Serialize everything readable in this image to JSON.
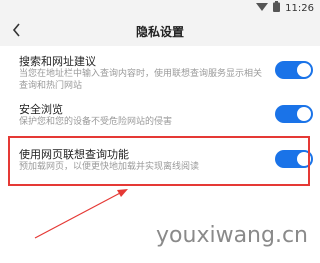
{
  "status_bar": {
    "time": "11:26",
    "icons": [
      "wifi-icon",
      "battery-icon"
    ]
  },
  "header": {
    "title": "隐私设置",
    "back_icon": "chevron-left-icon"
  },
  "settings": [
    {
      "title": "搜索和网址建议",
      "description": "当您在地址栏中输入查询内容时，使用联想查询服务显示相关查询和热门网站",
      "enabled": true
    },
    {
      "title": "安全浏览",
      "description": "保护您和您的设备不受危险网站的侵害",
      "enabled": true
    },
    {
      "title": "使用网页联想查询功能",
      "description": "预加载网页，以便更快地加载并实现离线阅读",
      "enabled": true,
      "highlighted": true
    }
  ],
  "colors": {
    "toggle_on": "#1a73e8",
    "highlight": "#e53935"
  },
  "watermark": "youxiwang.cn"
}
